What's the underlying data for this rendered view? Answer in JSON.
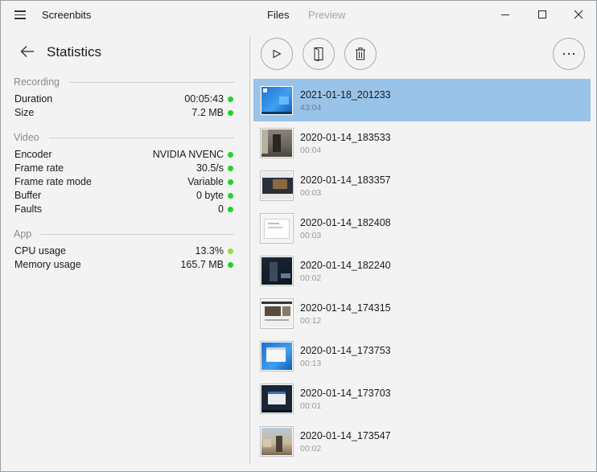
{
  "titlebar": {
    "app_title": "Screenbits",
    "tabs": [
      {
        "label": "Files",
        "active": true
      },
      {
        "label": "Preview",
        "active": false
      }
    ],
    "menu_icon": "hamburger-icon",
    "window_controls": [
      "minimize-icon",
      "maximize-icon",
      "close-icon"
    ]
  },
  "left": {
    "back_icon": "back-arrow-icon",
    "title": "Statistics",
    "sections": [
      {
        "title": "Recording",
        "rows": [
          {
            "label": "Duration",
            "value": "00:05:43",
            "status": "ok"
          },
          {
            "label": "Size",
            "value": "7.2 MB",
            "status": "ok"
          }
        ]
      },
      {
        "title": "Video",
        "rows": [
          {
            "label": "Encoder",
            "value": "NVIDIA NVENC",
            "status": "ok"
          },
          {
            "label": "Frame rate",
            "value": "30.5/s",
            "status": "ok"
          },
          {
            "label": "Frame rate mode",
            "value": "Variable",
            "status": "ok"
          },
          {
            "label": "Buffer",
            "value": "0 byte",
            "status": "ok"
          },
          {
            "label": "Faults",
            "value": "0",
            "status": "ok"
          }
        ]
      },
      {
        "title": "App",
        "rows": [
          {
            "label": "CPU usage",
            "value": "13.3%",
            "status": "warn"
          },
          {
            "label": "Memory usage",
            "value": "165.7 MB",
            "status": "ok"
          }
        ]
      }
    ],
    "status_colors": {
      "ok": "#22d32a",
      "warn": "#8ee03a"
    }
  },
  "toolbar": {
    "buttons": [
      "play-icon",
      "open-file-icon",
      "trash-icon",
      "more-icon"
    ]
  },
  "files": [
    {
      "name": "2021-01-18_201233",
      "duration": "43:04",
      "selected": true,
      "thumb": "desktop-blue"
    },
    {
      "name": "2020-01-14_183533",
      "duration": "00:04",
      "selected": false,
      "thumb": "game-scene"
    },
    {
      "name": "2020-01-14_183357",
      "duration": "00:03",
      "selected": false,
      "thumb": "video-editor"
    },
    {
      "name": "2020-01-14_182408",
      "duration": "00:03",
      "selected": false,
      "thumb": "window-white"
    },
    {
      "name": "2020-01-14_182240",
      "duration": "00:02",
      "selected": false,
      "thumb": "game-dark"
    },
    {
      "name": "2020-01-14_174315",
      "duration": "00:12",
      "selected": false,
      "thumb": "web-page"
    },
    {
      "name": "2020-01-14_173753",
      "duration": "00:13",
      "selected": false,
      "thumb": "desktop-blue-window"
    },
    {
      "name": "2020-01-14_173703",
      "duration": "00:01",
      "selected": false,
      "thumb": "desktop-dark"
    },
    {
      "name": "2020-01-14_173547",
      "duration": "00:02",
      "selected": false,
      "thumb": "game-outdoor"
    }
  ],
  "accent": {
    "selection": "#99c3e9"
  }
}
